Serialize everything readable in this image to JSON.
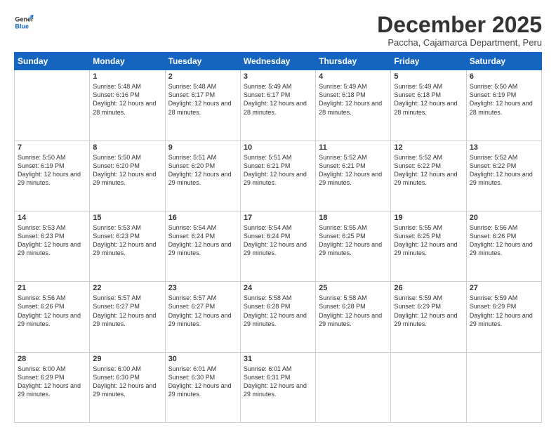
{
  "logo": {
    "line1": "General",
    "line2": "Blue"
  },
  "title": "December 2025",
  "subtitle": "Paccha, Cajamarca Department, Peru",
  "weekdays": [
    "Sunday",
    "Monday",
    "Tuesday",
    "Wednesday",
    "Thursday",
    "Friday",
    "Saturday"
  ],
  "weeks": [
    [
      {
        "day": "",
        "info": ""
      },
      {
        "day": "1",
        "info": "Sunrise: 5:48 AM\nSunset: 6:16 PM\nDaylight: 12 hours\nand 28 minutes."
      },
      {
        "day": "2",
        "info": "Sunrise: 5:48 AM\nSunset: 6:17 PM\nDaylight: 12 hours\nand 28 minutes."
      },
      {
        "day": "3",
        "info": "Sunrise: 5:49 AM\nSunset: 6:17 PM\nDaylight: 12 hours\nand 28 minutes."
      },
      {
        "day": "4",
        "info": "Sunrise: 5:49 AM\nSunset: 6:18 PM\nDaylight: 12 hours\nand 28 minutes."
      },
      {
        "day": "5",
        "info": "Sunrise: 5:49 AM\nSunset: 6:18 PM\nDaylight: 12 hours\nand 28 minutes."
      },
      {
        "day": "6",
        "info": "Sunrise: 5:50 AM\nSunset: 6:19 PM\nDaylight: 12 hours\nand 28 minutes."
      }
    ],
    [
      {
        "day": "7",
        "info": "Sunrise: 5:50 AM\nSunset: 6:19 PM\nDaylight: 12 hours\nand 29 minutes."
      },
      {
        "day": "8",
        "info": "Sunrise: 5:50 AM\nSunset: 6:20 PM\nDaylight: 12 hours\nand 29 minutes."
      },
      {
        "day": "9",
        "info": "Sunrise: 5:51 AM\nSunset: 6:20 PM\nDaylight: 12 hours\nand 29 minutes."
      },
      {
        "day": "10",
        "info": "Sunrise: 5:51 AM\nSunset: 6:21 PM\nDaylight: 12 hours\nand 29 minutes."
      },
      {
        "day": "11",
        "info": "Sunrise: 5:52 AM\nSunset: 6:21 PM\nDaylight: 12 hours\nand 29 minutes."
      },
      {
        "day": "12",
        "info": "Sunrise: 5:52 AM\nSunset: 6:22 PM\nDaylight: 12 hours\nand 29 minutes."
      },
      {
        "day": "13",
        "info": "Sunrise: 5:52 AM\nSunset: 6:22 PM\nDaylight: 12 hours\nand 29 minutes."
      }
    ],
    [
      {
        "day": "14",
        "info": "Sunrise: 5:53 AM\nSunset: 6:23 PM\nDaylight: 12 hours\nand 29 minutes."
      },
      {
        "day": "15",
        "info": "Sunrise: 5:53 AM\nSunset: 6:23 PM\nDaylight: 12 hours\nand 29 minutes."
      },
      {
        "day": "16",
        "info": "Sunrise: 5:54 AM\nSunset: 6:24 PM\nDaylight: 12 hours\nand 29 minutes."
      },
      {
        "day": "17",
        "info": "Sunrise: 5:54 AM\nSunset: 6:24 PM\nDaylight: 12 hours\nand 29 minutes."
      },
      {
        "day": "18",
        "info": "Sunrise: 5:55 AM\nSunset: 6:25 PM\nDaylight: 12 hours\nand 29 minutes."
      },
      {
        "day": "19",
        "info": "Sunrise: 5:55 AM\nSunset: 6:25 PM\nDaylight: 12 hours\nand 29 minutes."
      },
      {
        "day": "20",
        "info": "Sunrise: 5:56 AM\nSunset: 6:26 PM\nDaylight: 12 hours\nand 29 minutes."
      }
    ],
    [
      {
        "day": "21",
        "info": "Sunrise: 5:56 AM\nSunset: 6:26 PM\nDaylight: 12 hours\nand 29 minutes."
      },
      {
        "day": "22",
        "info": "Sunrise: 5:57 AM\nSunset: 6:27 PM\nDaylight: 12 hours\nand 29 minutes."
      },
      {
        "day": "23",
        "info": "Sunrise: 5:57 AM\nSunset: 6:27 PM\nDaylight: 12 hours\nand 29 minutes."
      },
      {
        "day": "24",
        "info": "Sunrise: 5:58 AM\nSunset: 6:28 PM\nDaylight: 12 hours\nand 29 minutes."
      },
      {
        "day": "25",
        "info": "Sunrise: 5:58 AM\nSunset: 6:28 PM\nDaylight: 12 hours\nand 29 minutes."
      },
      {
        "day": "26",
        "info": "Sunrise: 5:59 AM\nSunset: 6:29 PM\nDaylight: 12 hours\nand 29 minutes."
      },
      {
        "day": "27",
        "info": "Sunrise: 5:59 AM\nSunset: 6:29 PM\nDaylight: 12 hours\nand 29 minutes."
      }
    ],
    [
      {
        "day": "28",
        "info": "Sunrise: 6:00 AM\nSunset: 6:29 PM\nDaylight: 12 hours\nand 29 minutes."
      },
      {
        "day": "29",
        "info": "Sunrise: 6:00 AM\nSunset: 6:30 PM\nDaylight: 12 hours\nand 29 minutes."
      },
      {
        "day": "30",
        "info": "Sunrise: 6:01 AM\nSunset: 6:30 PM\nDaylight: 12 hours\nand 29 minutes."
      },
      {
        "day": "31",
        "info": "Sunrise: 6:01 AM\nSunset: 6:31 PM\nDaylight: 12 hours\nand 29 minutes."
      },
      {
        "day": "",
        "info": ""
      },
      {
        "day": "",
        "info": ""
      },
      {
        "day": "",
        "info": ""
      }
    ]
  ]
}
